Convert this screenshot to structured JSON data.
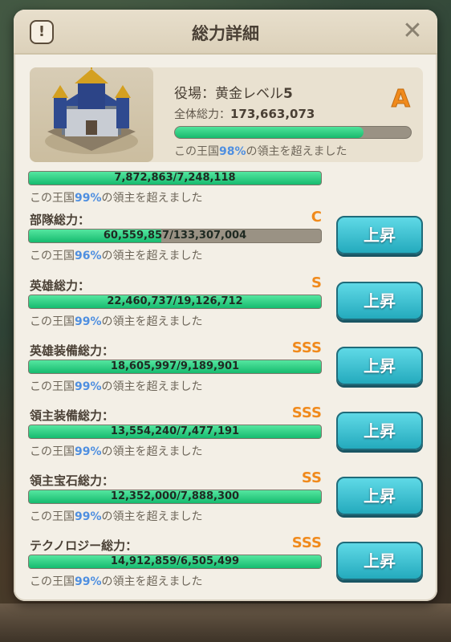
{
  "dialog": {
    "title": "総力詳細",
    "info_icon": "!",
    "close_icon": "✕"
  },
  "summary": {
    "role_prefix": "役場：黄金レベル",
    "role_level": "5",
    "total_label": "全体総力：",
    "total_value": "173,663,073",
    "grade": "A",
    "progress_fraction": 0.8,
    "surpass_prefix": "この王国",
    "surpass_pct": "98%",
    "surpass_suffix": "の領主を超えました"
  },
  "rows": [
    {
      "label": "",
      "grade": "",
      "bar_value": "7,872,863/7,248,118",
      "fill": 1.0,
      "sub_prefix": "この王国",
      "pct": "99%",
      "sub_suffix": "の領主を超えました",
      "button": ""
    },
    {
      "label": "部隊総力：",
      "grade": "C",
      "bar_value": "60,559,857/133,307,004",
      "fill": 0.454,
      "sub_prefix": "この王国",
      "pct": "96%",
      "sub_suffix": "の領主を超えました",
      "button": "上昇"
    },
    {
      "label": "英雄総力：",
      "grade": "S",
      "bar_value": "22,460,737/19,126,712",
      "fill": 1.0,
      "sub_prefix": "この王国",
      "pct": "99%",
      "sub_suffix": "の領主を超えました",
      "button": "上昇"
    },
    {
      "label": "英雄装備総力：",
      "grade": "SSS",
      "bar_value": "18,605,997/9,189,901",
      "fill": 1.0,
      "sub_prefix": "この王国",
      "pct": "99%",
      "sub_suffix": "の領主を超えました",
      "button": "上昇"
    },
    {
      "label": "領主装備総力：",
      "grade": "SSS",
      "bar_value": "13,554,240/7,477,191",
      "fill": 1.0,
      "sub_prefix": "この王国",
      "pct": "99%",
      "sub_suffix": "の領主を超えました",
      "button": "上昇"
    },
    {
      "label": "領主宝石総力：",
      "grade": "SS",
      "bar_value": "12,352,000/7,888,300",
      "fill": 1.0,
      "sub_prefix": "この王国",
      "pct": "99%",
      "sub_suffix": "の領主を超えました",
      "button": "上昇"
    },
    {
      "label": "テクノロジー総力：",
      "grade": "SSS",
      "bar_value": "14,912,859/6,505,499",
      "fill": 1.0,
      "sub_prefix": "この王国",
      "pct": "99%",
      "sub_suffix": "の領主を超えました",
      "button": "上昇"
    }
  ],
  "colors": {
    "accent_orange": "#f08a1c",
    "bar_green": "#16bb6f",
    "pct_blue": "#4f8fe0",
    "button_teal": "#24aabd"
  }
}
